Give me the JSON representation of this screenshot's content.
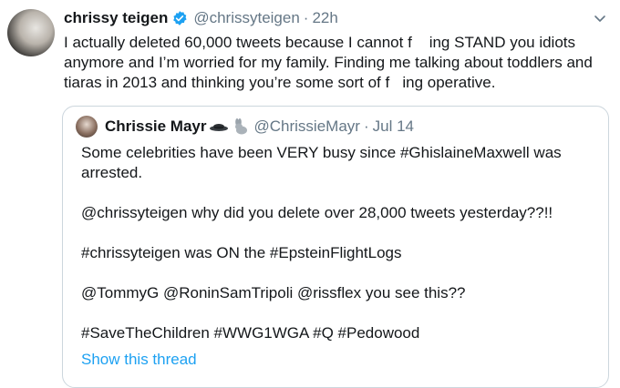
{
  "tweet": {
    "author_name": "chrissy teigen",
    "author_handle": "@chrissyteigen",
    "separator": "·",
    "time": "22h",
    "text": "I actually deleted 60,000 tweets because I cannot f    ing STAND you idiots anymore and I’m worried for my family. Finding me talking about toddlers and tiaras in 2013 and thinking you’re some sort of f   ing operative."
  },
  "quoted": {
    "author_name": "Chrissie Mayr",
    "author_handle": "@ChrissieMayr",
    "separator": "·",
    "time": "Jul 14",
    "paragraphs": [
      "Some celebrities have been VERY busy since #GhislaineMaxwell was arrested.",
      "@chrissyteigen why did you delete over 28,000 tweets yesterday??!!",
      "#chrissyteigen was ON the #EpsteinFlightLogs",
      "@TommyG @RoninSamTripoli @rissflex you see this??",
      "#SaveTheChildren #WWG1WGA #Q #Pedowood"
    ],
    "show_thread": "Show this thread"
  },
  "colors": {
    "text": "#14171a",
    "secondary": "#657786",
    "link": "#1da1f2",
    "border": "#ccd6dd"
  },
  "icons": {
    "verified": "verified-badge-icon",
    "menu": "chevron-down-icon",
    "emoji_1": "hat-emoji-icon",
    "emoji_2": "rabbit-emoji-icon"
  }
}
